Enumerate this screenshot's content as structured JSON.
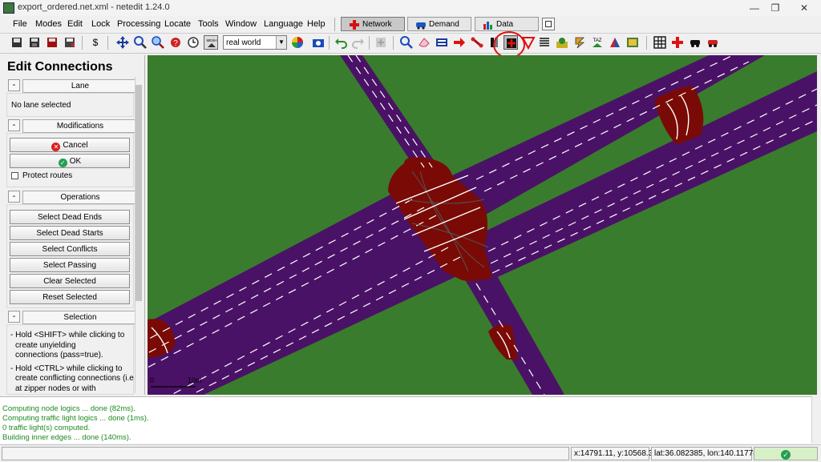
{
  "window": {
    "title": "export_ordered.net.xml - netedit 1.24.0",
    "minimize": "—",
    "restore": "❐",
    "close": "✕"
  },
  "menu": [
    "File",
    "Modes",
    "Edit",
    "Lock",
    "Processing",
    "Locate",
    "Tools",
    "Window",
    "Language",
    "Help"
  ],
  "supermodes": {
    "network": "Network",
    "demand": "Demand",
    "data": "Data"
  },
  "toolbar": {
    "view": "real world",
    "taz_label": "TAZ",
    "mesh_label": "MESH"
  },
  "panel": {
    "title": "Edit Connections",
    "lane": {
      "header": "Lane",
      "status": "No lane selected"
    },
    "modifications": {
      "header": "Modifications",
      "cancel": "Cancel",
      "ok": "OK",
      "protect": "Protect routes"
    },
    "operations": {
      "header": "Operations",
      "buttons": [
        "Select Dead Ends",
        "Select Dead Starts",
        "Select Conflicts",
        "Select Passing",
        "Clear Selected",
        "Reset Selected"
      ]
    },
    "selection": {
      "header": "Selection",
      "hints": [
        "- Hold <SHIFT> while clicking to",
        "create unyielding",
        "connections (pass=true).",
        "- Hold <CTRL> while clicking to",
        "create conflicting connections (i.e",
        "at zipper nodes or with"
      ]
    }
  },
  "map": {
    "scale_zero": "0",
    "scale_label": "10m"
  },
  "log": [
    "Computing node logics ... done (82ms).",
    "Computing traffic light logics ... done (1ms).",
    " 0 traffic light(s) computed.",
    "Building inner edges ... done (140ms)."
  ],
  "status": {
    "xy": "x:14791.11, y:10568.34",
    "latlon": "lat:36.082385, lon:140.117789"
  },
  "colors": {
    "map_bg": "#3a7c2d",
    "road": "#4a1266",
    "junction": "#7a0a05",
    "log_text": "#1c8a20",
    "highlight": "#e01010"
  }
}
